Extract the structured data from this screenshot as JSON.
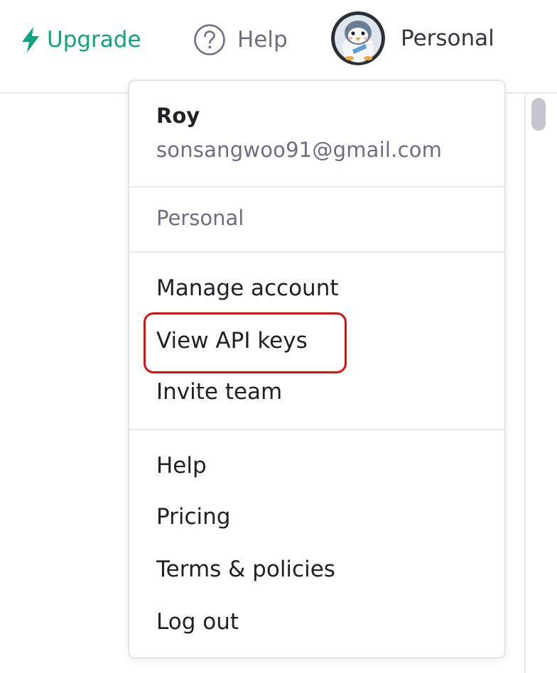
{
  "header": {
    "upgrade_label": "Upgrade",
    "help_label": "Help",
    "account_label": "Personal",
    "upgrade_icon": "lightning-bolt-icon",
    "help_icon": "question-circle-icon",
    "avatar_icon": "penguin-avatar"
  },
  "menu": {
    "user_name": "Roy",
    "user_email": "sonsangwoo91@gmail.com",
    "organization": "Personal",
    "account_items": [
      {
        "label": "Manage account"
      },
      {
        "label": "View API keys"
      },
      {
        "label": "Invite team"
      }
    ],
    "support_items": [
      {
        "label": "Help"
      },
      {
        "label": "Pricing"
      },
      {
        "label": "Terms & policies"
      },
      {
        "label": "Log out"
      }
    ]
  },
  "colors": {
    "accent": "#10a37f",
    "highlight": "#e01010",
    "text": "#202123",
    "muted": "#6e6e80"
  }
}
